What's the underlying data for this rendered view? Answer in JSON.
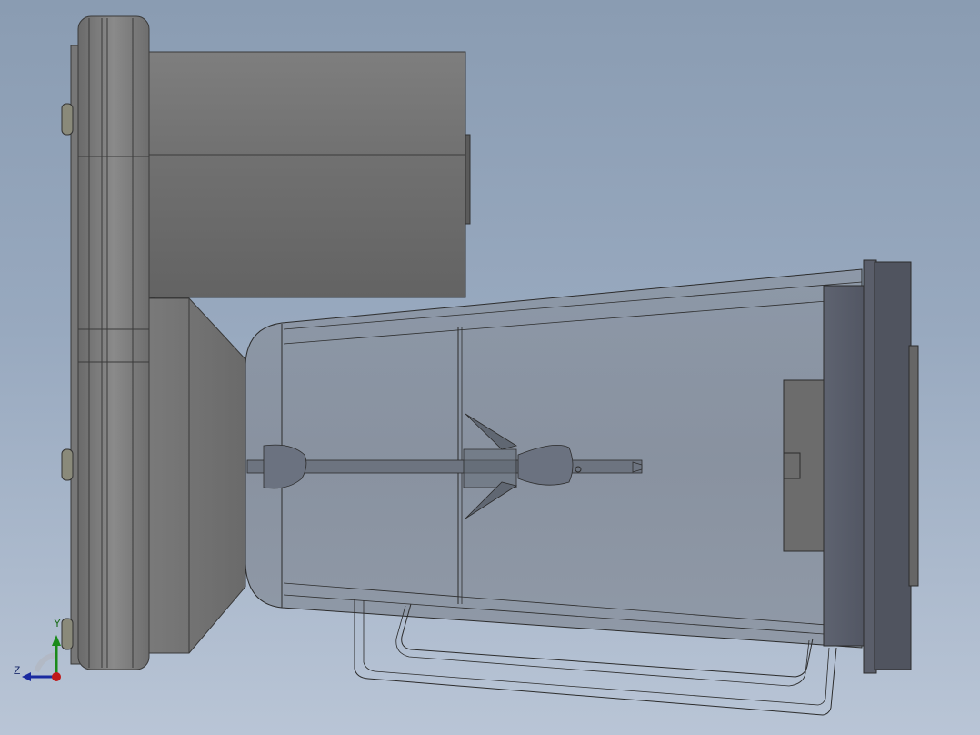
{
  "viewport": {
    "background_top": "#8a9cb2",
    "background_bottom": "#b9c5d6"
  },
  "model": {
    "description_icon": "blender-3d-model"
  },
  "triad": {
    "y_label": "Y",
    "z_label": "Z",
    "y_color": "#1a8a1a",
    "z_color": "#1a2aa0",
    "origin_color": "#c01818"
  }
}
